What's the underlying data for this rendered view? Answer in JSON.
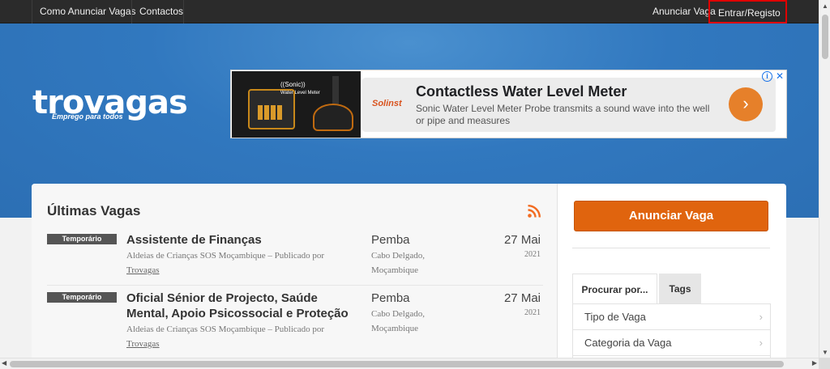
{
  "nav": {
    "how_to_post": "Como Anunciar Vagas",
    "contacts": "Contactos",
    "post_job": "Anunciar Vaga",
    "login": "Entrar/Registo"
  },
  "logo": {
    "word": "trovagas",
    "tagline": "Emprego para todos"
  },
  "ad": {
    "product_label": "((Sonic))",
    "product_sub": "Water Level Meter",
    "brand": "Solinst",
    "title": "Contactless Water Level Meter",
    "description": "Sonic Water Level Meter Probe transmits a sound wave into the well or pipe and measures",
    "button_glyph": "›",
    "info_glyph": "i",
    "close_glyph": "✕"
  },
  "latest": {
    "title": "Últimas Vagas",
    "jobs": [
      {
        "type": "Temporário",
        "title": "Assistente de Finanças",
        "company_line": "Aldeias de Crianças SOS Moçambique – Publicado por",
        "publisher": "Trovagas",
        "city": "Pemba",
        "region": "Cabo Delgado, Moçambique",
        "date": "27 Mai",
        "year": "2021"
      },
      {
        "type": "Temporário",
        "title": "Oficial Sénior de Projecto, Saúde Mental, Apoio Psicossocial e Proteção",
        "company_line": "Aldeias de Crianças SOS Moçambique – Publicado por",
        "publisher": "Trovagas",
        "city": "Pemba",
        "region": "Cabo Delgado, Moçambique",
        "date": "27 Mai",
        "year": "2021"
      }
    ]
  },
  "sidebar": {
    "post_button": "Anunciar Vaga",
    "tabs": [
      "Procurar por...",
      "Tags"
    ],
    "filters": [
      "Tipo de Vaga",
      "Categoria da Vaga",
      ""
    ]
  },
  "colors": {
    "topbar": "#2b2b2b",
    "hero": "#3178bf",
    "accent_orange": "#e0640e",
    "highlight_red": "#e00000"
  }
}
